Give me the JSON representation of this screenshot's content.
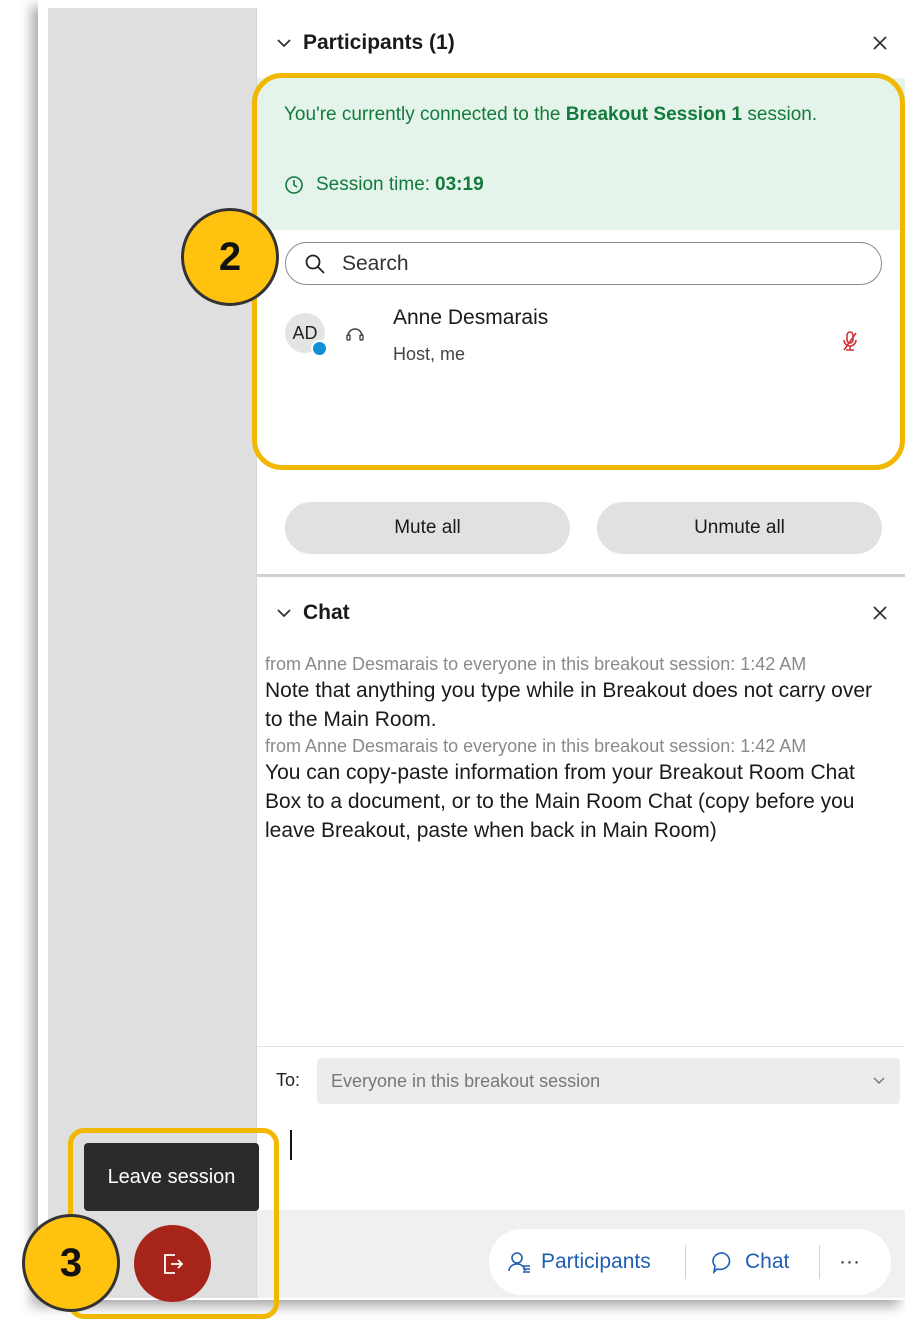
{
  "participants": {
    "title": "Participants (1)",
    "connected_prefix": "You're currently connected to the ",
    "session_name": "Breakout Session 1",
    "connected_suffix": " session.",
    "session_time_label": "Session time:",
    "session_time_value": "03:19",
    "search_placeholder": "Search",
    "people": [
      {
        "initials": "AD",
        "name": "Anne Desmarais",
        "role": "Host, me",
        "muted": true
      }
    ],
    "mute_all_label": "Mute all",
    "unmute_all_label": "Unmute all"
  },
  "chat": {
    "title": "Chat",
    "messages": [
      {
        "meta": "from Anne Desmarais to everyone in this breakout session:   1:42 AM",
        "text": "Note that anything you type while in Breakout does not carry over to the Main Room."
      },
      {
        "meta": "from Anne Desmarais to everyone in this breakout session:   1:42 AM",
        "text": "You can copy-paste information from your Breakout Room Chat Box to a document, or to the Main Room Chat (copy before you leave Breakout, paste when back in Main Room)"
      }
    ],
    "to_label": "To:",
    "to_value": "Everyone in this breakout session"
  },
  "bottom_bar": {
    "participants_label": "Participants",
    "chat_label": "Chat",
    "more_label": "···"
  },
  "leave": {
    "tooltip": "Leave session"
  },
  "annotations": {
    "badge_2": "2",
    "badge_3": "3"
  },
  "colors": {
    "highlight": "#f2b700",
    "badge": "#ffc20e",
    "connected_green": "#137a3d",
    "green_bg": "#e4f4eb",
    "leave_red": "#a7241b",
    "link_blue": "#1e5fb3"
  },
  "icons": {
    "collapse": "chevron-down-icon",
    "close": "close-icon",
    "clock": "clock-icon",
    "search": "search-icon",
    "headset": "headset-icon",
    "mic_muted": "microphone-muted-icon",
    "dropdown": "chevron-down-icon",
    "participants": "people-icon",
    "chat": "chat-bubble-icon",
    "leave": "leave-door-icon"
  }
}
